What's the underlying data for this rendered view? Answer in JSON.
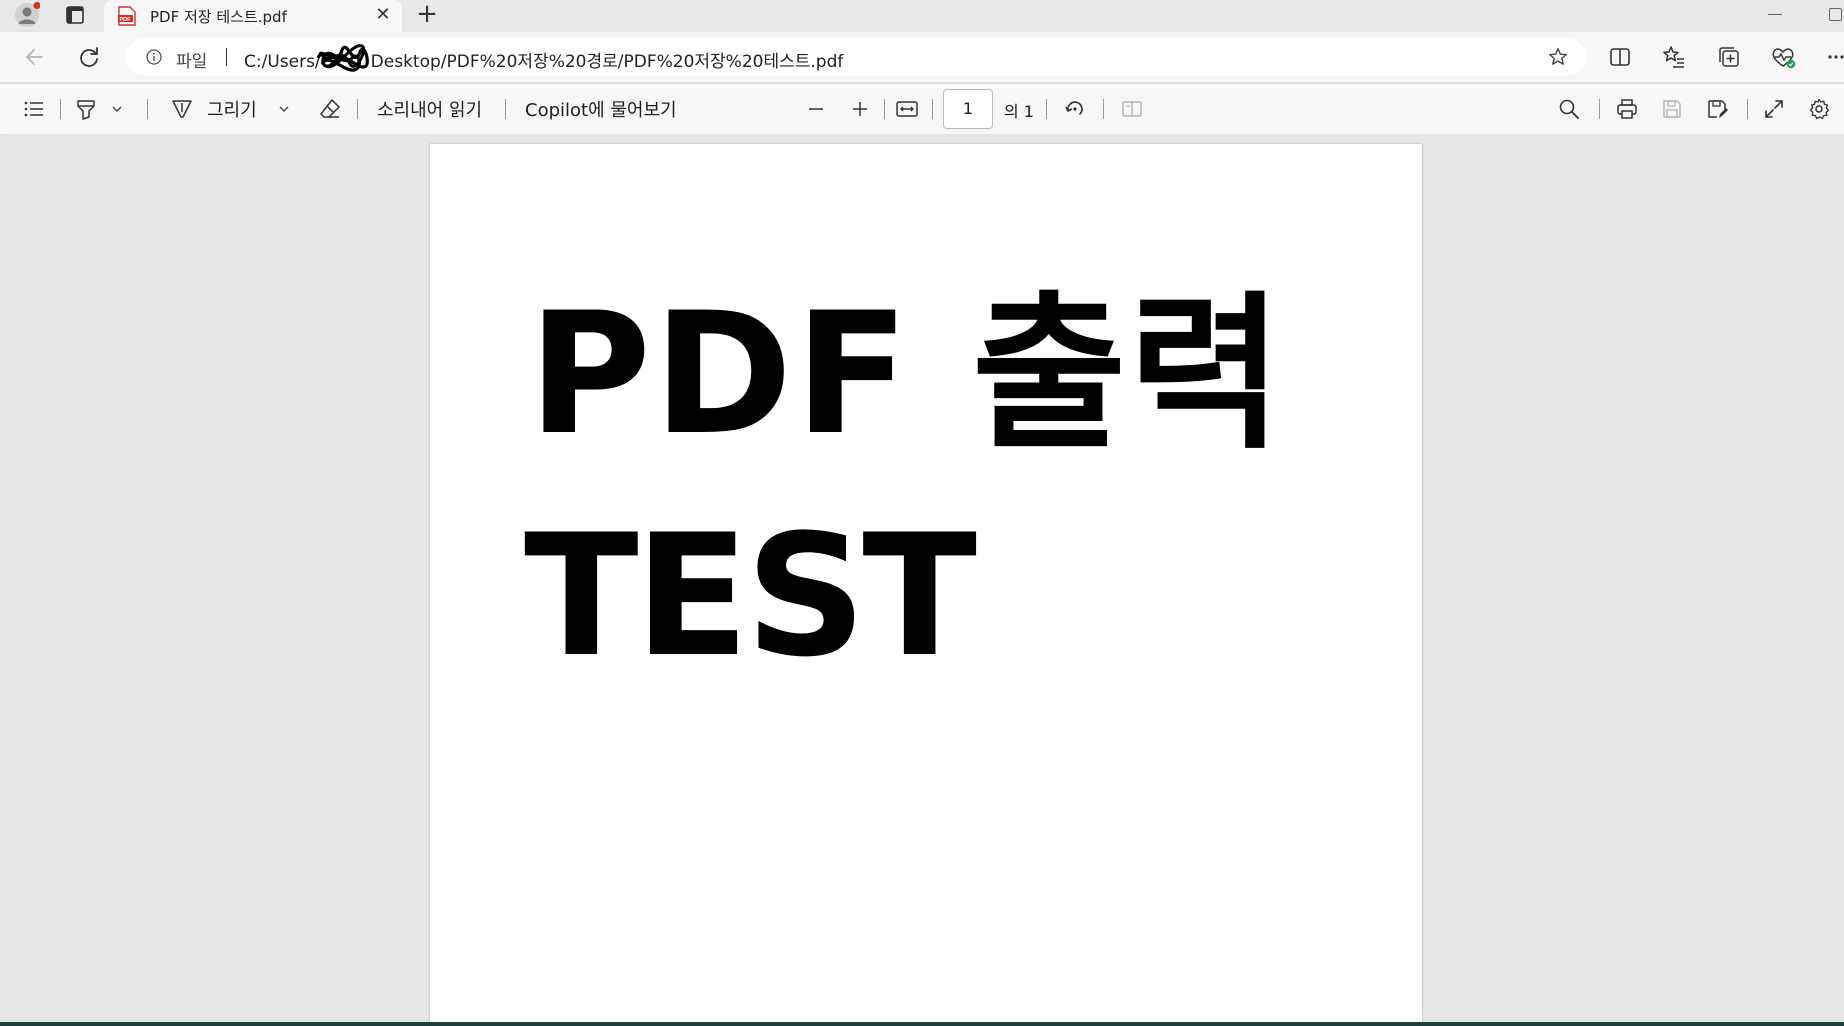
{
  "browser": {
    "tab": {
      "title": "PDF 저장 테스트.pdf",
      "close_glyph": "✕",
      "icon": "pdf-file-icon"
    },
    "new_tab_glyph": "+",
    "address_bar": {
      "scheme_label": "파일",
      "url_prefix": "C:/Users/",
      "url_suffix": "Desktop/PDF%20저장%20경로/PDF%20저장%20테스트.pdf"
    }
  },
  "pdf_toolbar": {
    "draw_label": "그리기",
    "read_aloud_label": "소리내어 읽기",
    "copilot_label": "Copilot에 물어보기",
    "page_number": "1",
    "page_total": "의 1"
  },
  "document": {
    "line1": "PDF 출력",
    "line2": "TEST"
  },
  "colors": {
    "tab_icon_red": "#d93025",
    "profile_dot": "#d93025",
    "bottom_bar": "#1d3d3d"
  }
}
